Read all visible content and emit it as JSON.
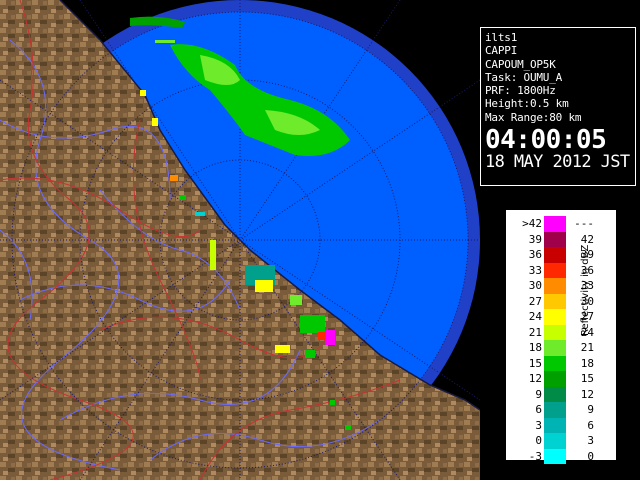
{
  "info": {
    "site": "ilts1",
    "product": "CAPPI",
    "task_id": "CAPOUM_OP5K",
    "task": "Task: OUMU_A",
    "prf": "PRF: 1800Hz",
    "height": "Height:0.5 km",
    "max_range": "Max Range:80 km",
    "time": "04:00:05",
    "date": "18 MAY 2012 JST"
  },
  "legend": {
    "unit": "Reflectivity in dBZ",
    "rows": [
      {
        "lo": ">42",
        "hi": "---",
        "color": "#ff00ff"
      },
      {
        "lo": "39",
        "hi": "42",
        "color": "#a0004a"
      },
      {
        "lo": "36",
        "hi": "39",
        "color": "#c80000"
      },
      {
        "lo": "33",
        "hi": "36",
        "color": "#ff2800"
      },
      {
        "lo": "30",
        "hi": "33",
        "color": "#ff8c00"
      },
      {
        "lo": "27",
        "hi": "30",
        "color": "#ffc800"
      },
      {
        "lo": "24",
        "hi": "27",
        "color": "#ffff00"
      },
      {
        "lo": "21",
        "hi": "24",
        "color": "#c8ff00"
      },
      {
        "lo": "18",
        "hi": "21",
        "color": "#6eeb2a"
      },
      {
        "lo": "15",
        "hi": "18",
        "color": "#00c800"
      },
      {
        "lo": "12",
        "hi": "15",
        "color": "#00a000"
      },
      {
        "lo": "9",
        "hi": "12",
        "color": "#008c46"
      },
      {
        "lo": "6",
        "hi": "9",
        "color": "#00a08c"
      },
      {
        "lo": "3",
        "hi": "6",
        "color": "#00b4b4"
      },
      {
        "lo": "0",
        "hi": "3",
        "color": "#00d2d2"
      },
      {
        "lo": "-3",
        "hi": "0",
        "color": "#00ffff"
      }
    ]
  },
  "colors": {
    "sea_inner": "#0060ff",
    "sea_outer": "#2040c8",
    "land": "#8a6a44",
    "rivers": "#6a6aff",
    "borders": "#c83232",
    "range_rings": "#1a1a6a"
  }
}
